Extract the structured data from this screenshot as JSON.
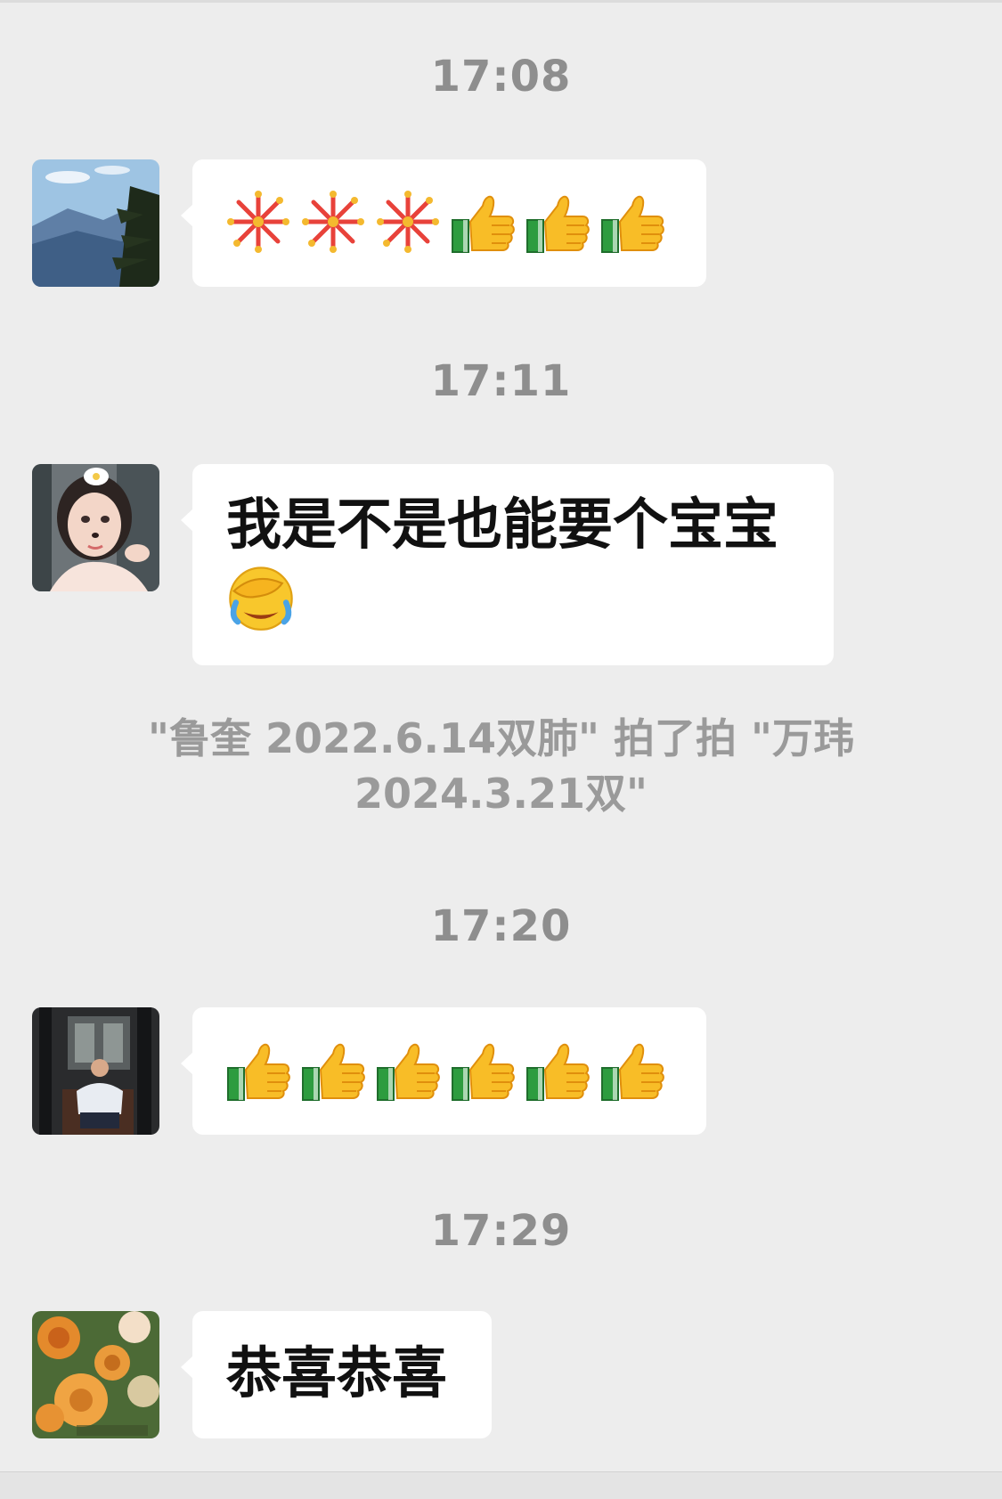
{
  "chat": {
    "messages": [
      {
        "time": "17:08",
        "sender_avatar": "mountain-pine-avatar",
        "content_type": "emoji",
        "emojis": [
          "fireworks-icon",
          "fireworks-icon",
          "fireworks-icon",
          "thumbs-up-icon",
          "thumbs-up-icon",
          "thumbs-up-icon"
        ]
      },
      {
        "time": "17:11",
        "sender_avatar": "woman-portrait-avatar",
        "content_type": "text",
        "text": "我是不是也能要个宝宝",
        "trailing_emoji": "facepalm-laugh-icon"
      },
      {
        "system": "\"鲁奎 2022.6.14双肺\" 拍了拍 \"万玮 2024.3.21双\""
      },
      {
        "time": "17:20",
        "sender_avatar": "man-in-chair-avatar",
        "content_type": "emoji",
        "emojis": [
          "thumbs-up-icon",
          "thumbs-up-icon",
          "thumbs-up-icon",
          "thumbs-up-icon",
          "thumbs-up-icon",
          "thumbs-up-icon"
        ]
      },
      {
        "time": "17:29",
        "sender_avatar": "flowers-avatar",
        "content_type": "text",
        "text": "恭喜恭喜"
      }
    ]
  },
  "colors": {
    "background": "#ededed",
    "bubble": "#ffffff",
    "timestamp": "#8e8e8e",
    "text": "#111111"
  }
}
